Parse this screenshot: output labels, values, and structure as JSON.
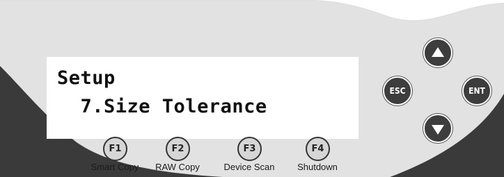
{
  "lcd": {
    "line1": "Setup",
    "line2": "  7.Size Tolerance"
  },
  "function_keys": [
    {
      "key": "F1",
      "label": "Smart Copy"
    },
    {
      "key": "F2",
      "label": "RAW Copy"
    },
    {
      "key": "F3",
      "label": "Device Scan"
    },
    {
      "key": "F4",
      "label": "Shutdown"
    }
  ],
  "nav_buttons": {
    "up_icon": "arrow-up-icon",
    "down_icon": "arrow-down-icon",
    "esc_label": "ESC",
    "ent_label": "ENT"
  },
  "colors": {
    "panel": "#e1e1e1",
    "panel_dark": "#3a3a3a",
    "button": "#3d3d3d",
    "lcd_background": "#ffffff"
  }
}
